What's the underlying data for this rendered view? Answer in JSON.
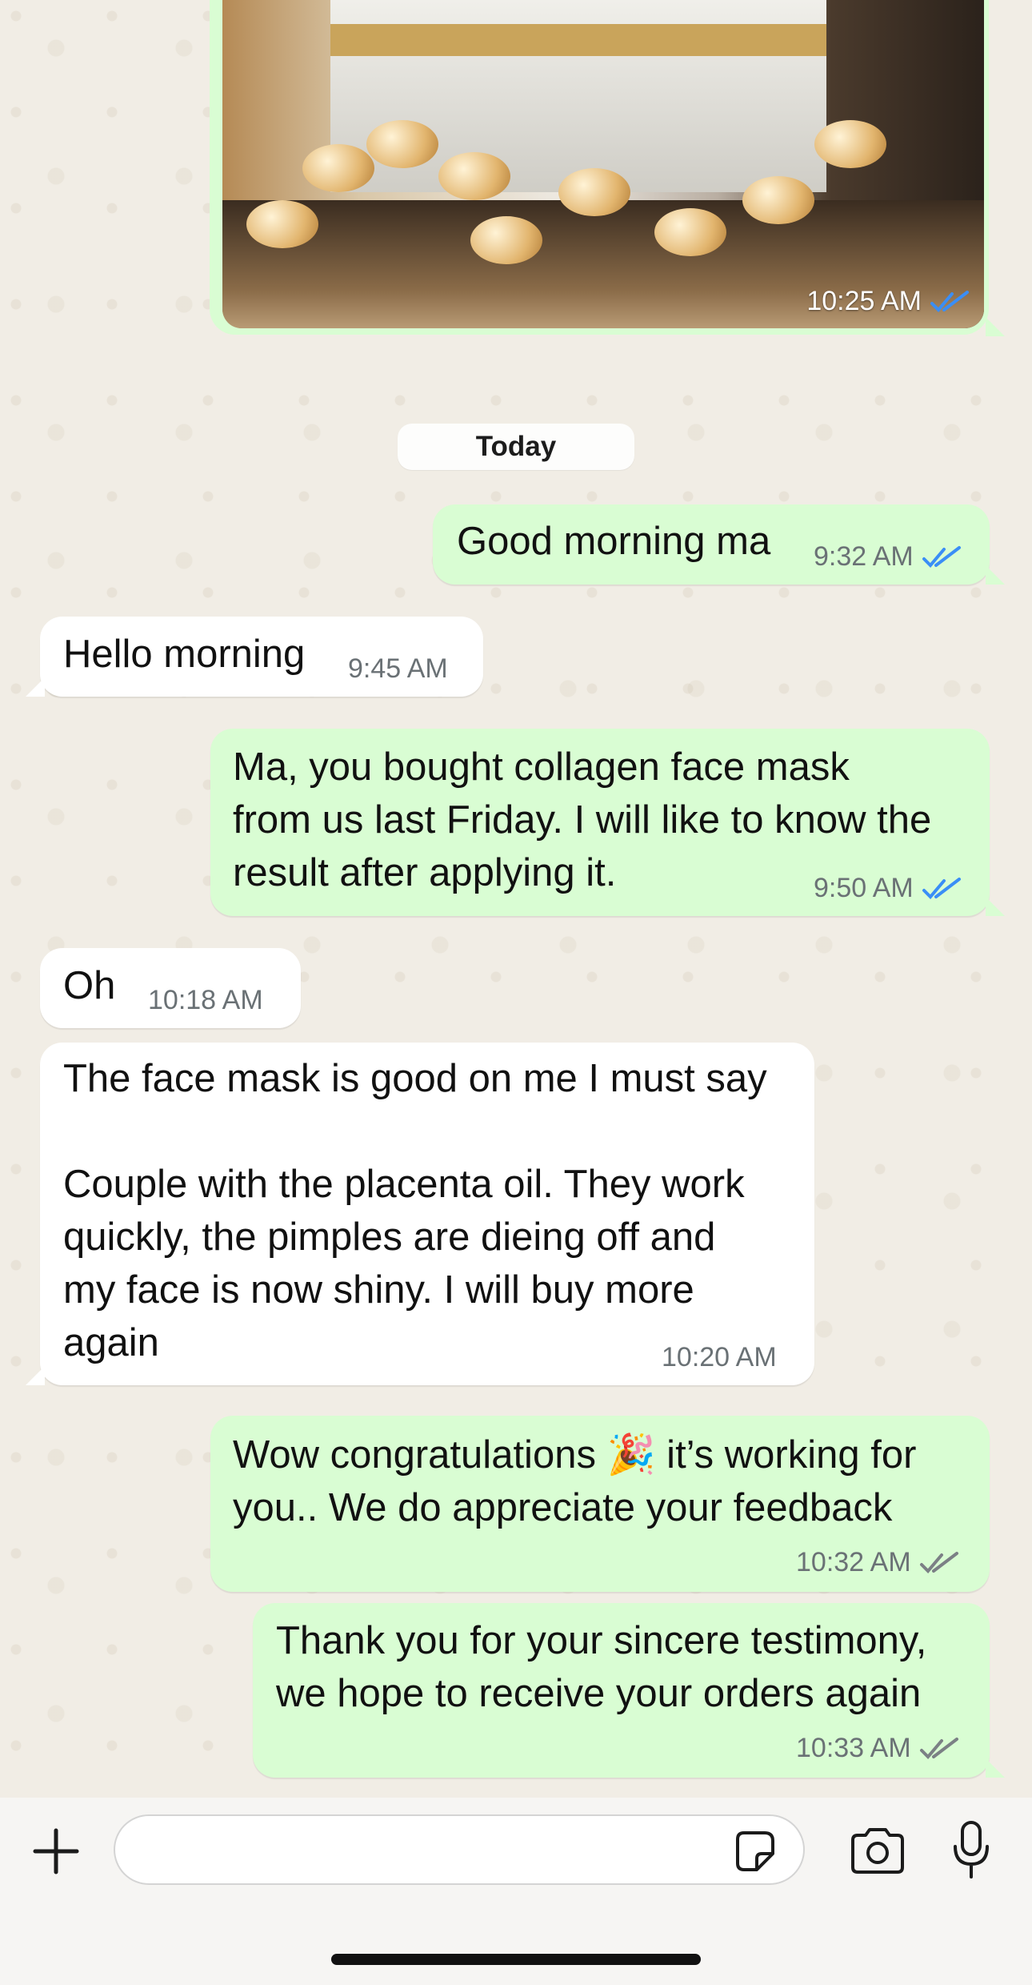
{
  "chat": {
    "image_message": {
      "time": "10:25 AM",
      "read": true
    },
    "date_divider": "Today",
    "messages": [
      {
        "direction": "out",
        "text": "Good morning ma",
        "time": "9:32 AM",
        "read": true
      },
      {
        "direction": "in",
        "text": "Hello morning",
        "time": "9:45 AM"
      },
      {
        "direction": "out",
        "text": "Ma, you bought collagen face mask\nfrom us last Friday. I will like to know the\nresult after applying it.",
        "time": "9:50 AM",
        "read": true
      },
      {
        "direction": "in",
        "text": "Oh",
        "time": "10:18 AM"
      },
      {
        "direction": "in",
        "text": "The face mask is good on me I must say\n\nCouple with the placenta oil. They work\nquickly, the pimples are dieing off and\nmy face is now shiny. I will buy more\nagain",
        "time": "10:20 AM"
      },
      {
        "direction": "out",
        "text": "Wow congratulations 🎉 it’s working for\nyou.. We do appreciate your feedback",
        "time": "10:32 AM",
        "read": false
      },
      {
        "direction": "out",
        "text": "Thank you for your sincere testimony,\nwe hope to receive your orders again",
        "time": "10:33 AM",
        "read": false
      }
    ]
  },
  "colors": {
    "outgoing_bubble": "#d9fdd3",
    "incoming_bubble": "#ffffff",
    "read_ticks": "#3a8ef6",
    "delivered_ticks": "#7b8085"
  },
  "composer": {
    "icons": [
      "plus-icon",
      "sticker-icon",
      "camera-icon",
      "microphone-icon"
    ]
  }
}
